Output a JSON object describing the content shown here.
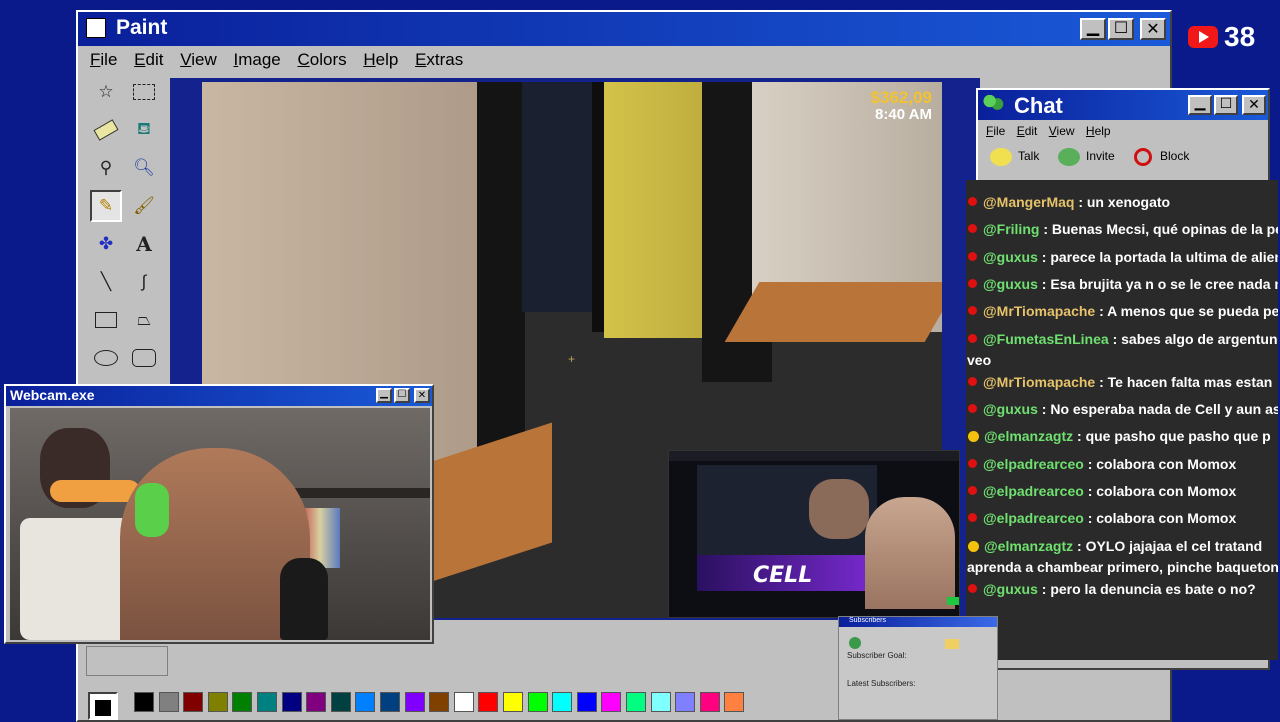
{
  "paint": {
    "title": "Paint",
    "menu": [
      "File",
      "Edit",
      "View",
      "Image",
      "Colors",
      "Help",
      "Extras"
    ],
    "tools": [
      "free-select",
      "rect-select",
      "eraser",
      "fill",
      "picker",
      "magnifier",
      "pencil",
      "brush",
      "airbrush",
      "text",
      "line",
      "curve",
      "rectangle",
      "polygon",
      "ellipse",
      "rounded-rect"
    ],
    "palette": [
      "#000000",
      "#808080",
      "#800000",
      "#808000",
      "#008000",
      "#008080",
      "#000080",
      "#800080",
      "#004040",
      "#0080ff",
      "#004080",
      "#8000ff",
      "#804000",
      "#ffffff",
      "#ff0000",
      "#ffff00",
      "#00ff00",
      "#00ffff",
      "#0000ff",
      "#ff00ff",
      "#00ff80",
      "#80ffff",
      "#8080ff",
      "#ff0080",
      "#ff8040"
    ]
  },
  "game": {
    "money": "$362,09",
    "time": "8:40 AM"
  },
  "youtube": {
    "count": "38"
  },
  "webcam": {
    "title": "Webcam.exe"
  },
  "chat": {
    "title": "Chat",
    "menu": [
      "File",
      "Edit",
      "View",
      "Help"
    ],
    "toolbar": [
      "Talk",
      "Invite",
      "Block"
    ],
    "messages": [
      {
        "user": "@MangerMaq",
        "text": " : un xenogato",
        "style": "gold",
        "badge": "yt"
      },
      {
        "user": "@Friling",
        "text": " : Buenas Mecsi, qué opinas de la pe",
        "style": "green",
        "badge": "yt"
      },
      {
        "user": "@guxus",
        "text": " : parece la portada la ultima de alien",
        "style": "green",
        "badge": "yt"
      },
      {
        "user": "@guxus",
        "text": " : Esa brujita ya n o se le cree nada m",
        "style": "green",
        "badge": "yt"
      },
      {
        "user": "@MrTiomapache",
        "text": " : A menos que se pueda pe",
        "style": "gold",
        "badge": "yt"
      },
      {
        "user": "@FumetasEnLinea",
        "text": " : sabes algo de argentun",
        "style": "green",
        "badge": "yt",
        "cont": "veo"
      },
      {
        "user": "@MrTiomapache",
        "text": " : Te hacen falta mas estan",
        "style": "gold",
        "badge": "yt"
      },
      {
        "user": "@guxus",
        "text": " : No esperaba nada de Cell y aun as",
        "style": "green",
        "badge": "yt"
      },
      {
        "user": "@elmanzagtz",
        "text": " : que pasho que pasho que p",
        "style": "green",
        "badge": "star"
      },
      {
        "user": "@elpadrearceo",
        "text": " : colabora con Momox",
        "style": "green",
        "badge": "yt"
      },
      {
        "user": "@elpadrearceo",
        "text": " : colabora con Momox",
        "style": "green",
        "badge": "yt"
      },
      {
        "user": "@elpadrearceo",
        "text": " : colabora con Momox",
        "style": "green",
        "badge": "yt"
      },
      {
        "user": "@elmanzagtz",
        "text": " : OYLO jajajaa el cel tratand",
        "style": "green",
        "badge": "star",
        "cont": "aprenda a chambear primero, pinche baqueton"
      },
      {
        "user": "@guxus",
        "text": " : pero la denuncia es bate o no?",
        "style": "green",
        "badge": "yt"
      }
    ]
  },
  "subs": {
    "title": "Subscribers",
    "goal": "Subscriber Goal:",
    "latest": "Latest Subscribers:"
  },
  "embed": {
    "logo": "CELL"
  }
}
